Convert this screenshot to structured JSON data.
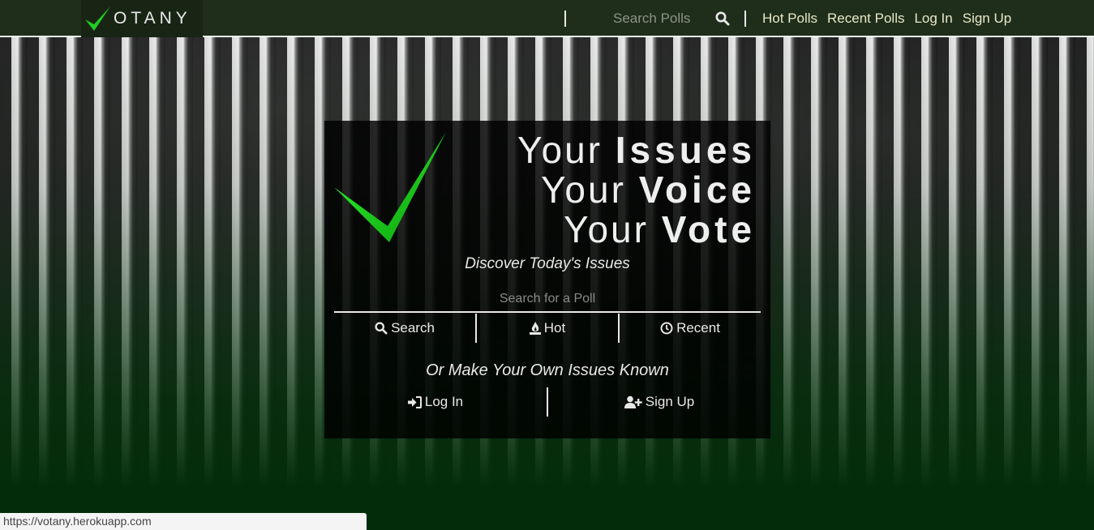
{
  "brand": {
    "name": "OTANY",
    "accent": "#22cc22"
  },
  "navbar": {
    "search_placeholder": "Search Polls",
    "links": [
      "Hot Polls",
      "Recent Polls",
      "Log In",
      "Sign Up"
    ]
  },
  "hero": {
    "headline": [
      {
        "light": "Your",
        "bold": "Issues"
      },
      {
        "light": "Your",
        "bold": "Voice"
      },
      {
        "light": "Your",
        "bold": "Vote"
      }
    ],
    "discover": "Discover Today's Issues",
    "poll_search_placeholder": "Search for a Poll",
    "buttons": {
      "search": "Search",
      "hot": "Hot",
      "recent": "Recent"
    },
    "own": "Or Make Your Own Issues Known",
    "login": "Log In",
    "signup": "Sign Up"
  },
  "status_url": "https://votany.herokuapp.com",
  "icons": [
    "check-logo-icon",
    "search-icon",
    "fire-icon",
    "clock-icon",
    "sign-in-icon",
    "user-plus-icon"
  ]
}
